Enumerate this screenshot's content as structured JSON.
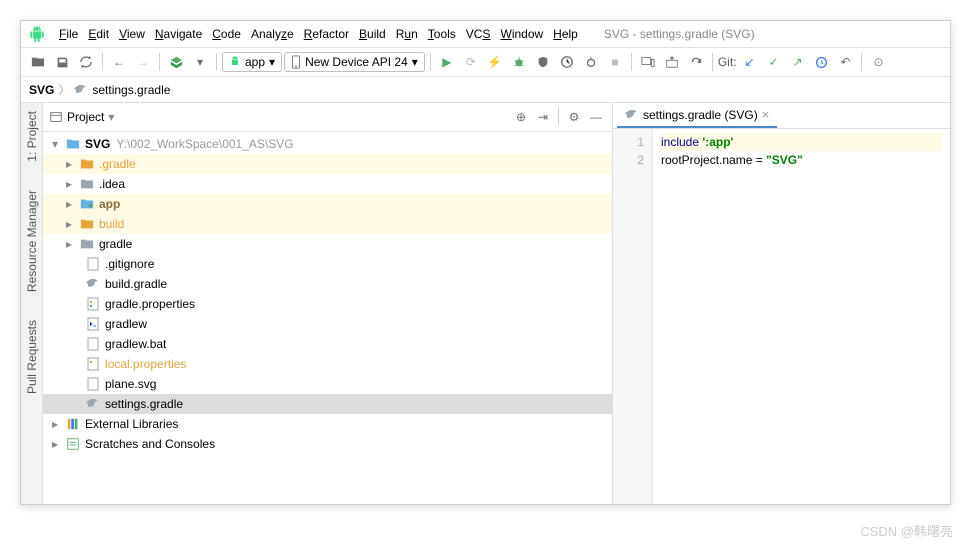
{
  "title": "SVG - settings.gradle (SVG)",
  "menu": [
    "File",
    "Edit",
    "View",
    "Navigate",
    "Code",
    "Analyze",
    "Refactor",
    "Build",
    "Run",
    "Tools",
    "VCS",
    "Window",
    "Help"
  ],
  "combo_app": "app",
  "combo_device": "New Device API 24",
  "git_label": "Git:",
  "breadcrumb": {
    "root": "SVG",
    "file": "settings.gradle"
  },
  "panel_title": "Project",
  "leftbar": {
    "project": "1: Project",
    "resmgr": "Resource Manager",
    "pull": "Pull Requests"
  },
  "tree": {
    "root": "SVG",
    "root_hint": "Y:\\002_WorkSpace\\001_AS\\SVG",
    "gradle_dir": ".gradle",
    "idea_dir": ".idea",
    "app_dir": "app",
    "build_dir": "build",
    "gradle_plain": "gradle",
    "gitignore": ".gitignore",
    "build_gradle": "build.gradle",
    "gradle_props": "gradle.properties",
    "gradlew": "gradlew",
    "gradlew_bat": "gradlew.bat",
    "local_props": "local.properties",
    "plane_svg": "plane.svg",
    "settings_gradle": "settings.gradle",
    "ext_lib": "External Libraries",
    "scratches": "Scratches and Consoles"
  },
  "editor": {
    "tab": "settings.gradle (SVG)",
    "lines": {
      "n1": "1",
      "n2": "2"
    },
    "code": {
      "l1_kw": "include",
      "l1_str": "':app'",
      "l2_a": "rootProject.name = ",
      "l2_str": "\"SVG\""
    }
  },
  "watermark": "CSDN @韩曙亮"
}
